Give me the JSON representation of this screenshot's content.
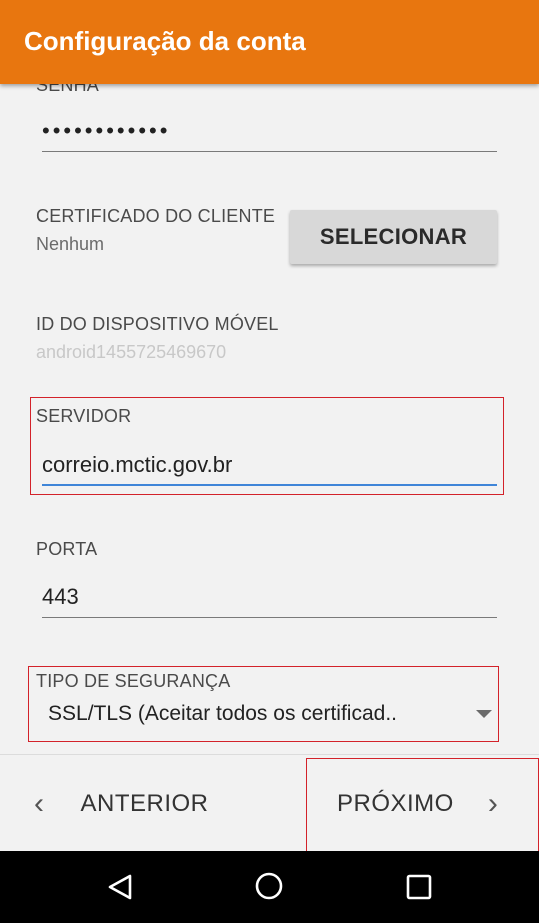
{
  "appbar": {
    "title": "Configuração da conta"
  },
  "password": {
    "label": "SENHA",
    "value": "••••••••••••"
  },
  "client_cert": {
    "label": "CERTIFICADO DO CLIENTE",
    "value": "Nenhum",
    "button_label": "SELECIONAR"
  },
  "device_id": {
    "label": "ID DO DISPOSITIVO MÓVEL",
    "value": "android1455725469670"
  },
  "server": {
    "label": "SERVIDOR",
    "value": "correio.mctic.gov.br"
  },
  "port": {
    "label": "PORTA",
    "value": "443"
  },
  "security": {
    "label": "TIPO DE SEGURANÇA",
    "selected": "SSL/TLS (Aceitar todos os certificad.."
  },
  "bottom_nav": {
    "back_label": "ANTERIOR",
    "next_label": "PRÓXIMO"
  },
  "colors": {
    "appbar": "#e8760f",
    "focus_underline": "#3f85d8",
    "highlight_box": "#d3222a"
  },
  "icons": {
    "back": "chevron-left-icon",
    "next": "chevron-right-icon",
    "sys_back": "triangle-back-icon",
    "sys_home": "circle-home-icon",
    "sys_recent": "square-recent-icon"
  }
}
